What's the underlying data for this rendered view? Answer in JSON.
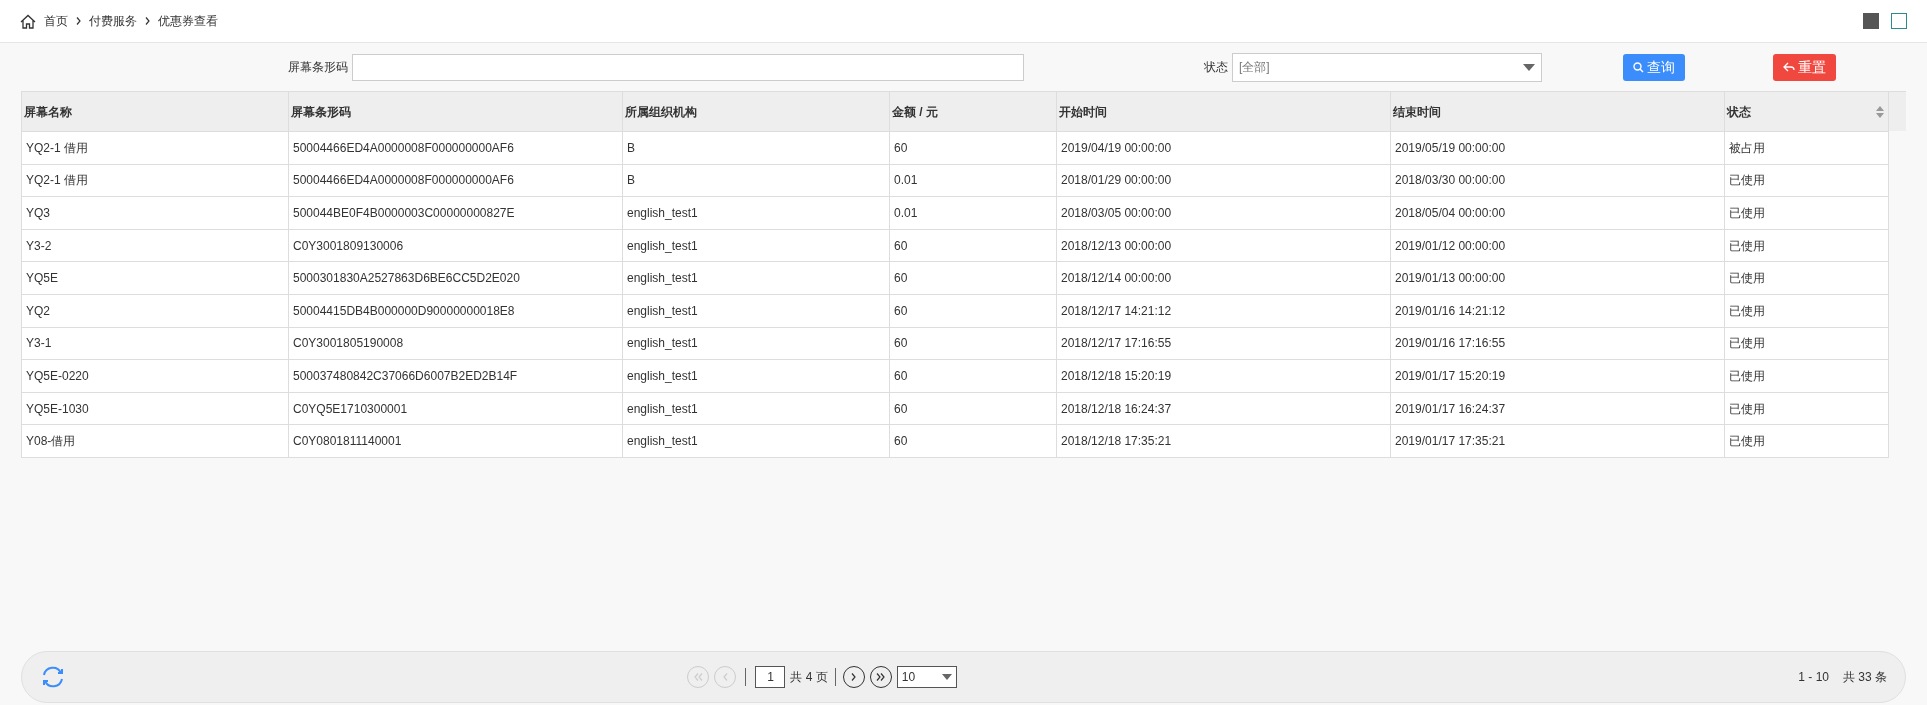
{
  "breadcrumb": [
    "首页",
    "付费服务",
    "优惠券查看"
  ],
  "filters": {
    "barcode_label": "屏幕条形码",
    "status_label": "状态",
    "status_value": "[全部]",
    "search_button": "查询",
    "reset_button": "重置"
  },
  "table": {
    "columns": [
      "屏幕名称",
      "屏幕条形码",
      "所属组织机构",
      "金额 / 元",
      "开始时间",
      "结束时间",
      "状态"
    ],
    "rows": [
      [
        "YQ2-1 借用",
        "50004466ED4A0000008F000000000AF6",
        "B",
        "60",
        "2019/04/19 00:00:00",
        "2019/05/19 00:00:00",
        "被占用"
      ],
      [
        "YQ2-1 借用",
        "50004466ED4A0000008F000000000AF6",
        "B",
        "0.01",
        "2018/01/29 00:00:00",
        "2018/03/30 00:00:00",
        "已使用"
      ],
      [
        "YQ3",
        "500044BE0F4B0000003C00000000827E",
        "english_test1",
        "0.01",
        "2018/03/05 00:00:00",
        "2018/05/04 00:00:00",
        "已使用"
      ],
      [
        "Y3-2",
        "C0Y3001809130006",
        "english_test1",
        "60",
        "2018/12/13 00:00:00",
        "2019/01/12 00:00:00",
        "已使用"
      ],
      [
        "YQ5E",
        "5000301830A2527863D6BE6CC5D2E020",
        "english_test1",
        "60",
        "2018/12/14 00:00:00",
        "2019/01/13 00:00:00",
        "已使用"
      ],
      [
        "YQ2",
        "50004415DB4B000000D90000000018E8",
        "english_test1",
        "60",
        "2018/12/17 14:21:12",
        "2019/01/16 14:21:12",
        "已使用"
      ],
      [
        "Y3-1",
        "C0Y3001805190008",
        "english_test1",
        "60",
        "2018/12/17 17:16:55",
        "2019/01/16 17:16:55",
        "已使用"
      ],
      [
        "YQ5E-0220",
        "500037480842C37066D6007B2ED2B14F",
        "english_test1",
        "60",
        "2018/12/18 15:20:19",
        "2019/01/17 15:20:19",
        "已使用"
      ],
      [
        "YQ5E-1030",
        "C0YQ5E1710300001",
        "english_test1",
        "60",
        "2018/12/18 16:24:37",
        "2019/01/17 16:24:37",
        "已使用"
      ],
      [
        "Y08-借用",
        "C0Y0801811140001",
        "english_test1",
        "60",
        "2018/12/18 17:35:21",
        "2019/01/17 17:35:21",
        "已使用"
      ]
    ]
  },
  "pager": {
    "first_disabled": true,
    "prev_disabled": true,
    "page": "1",
    "total_pages": "共 4 页",
    "page_size": "10",
    "range": "1 - 10",
    "total": "共 33 条"
  }
}
